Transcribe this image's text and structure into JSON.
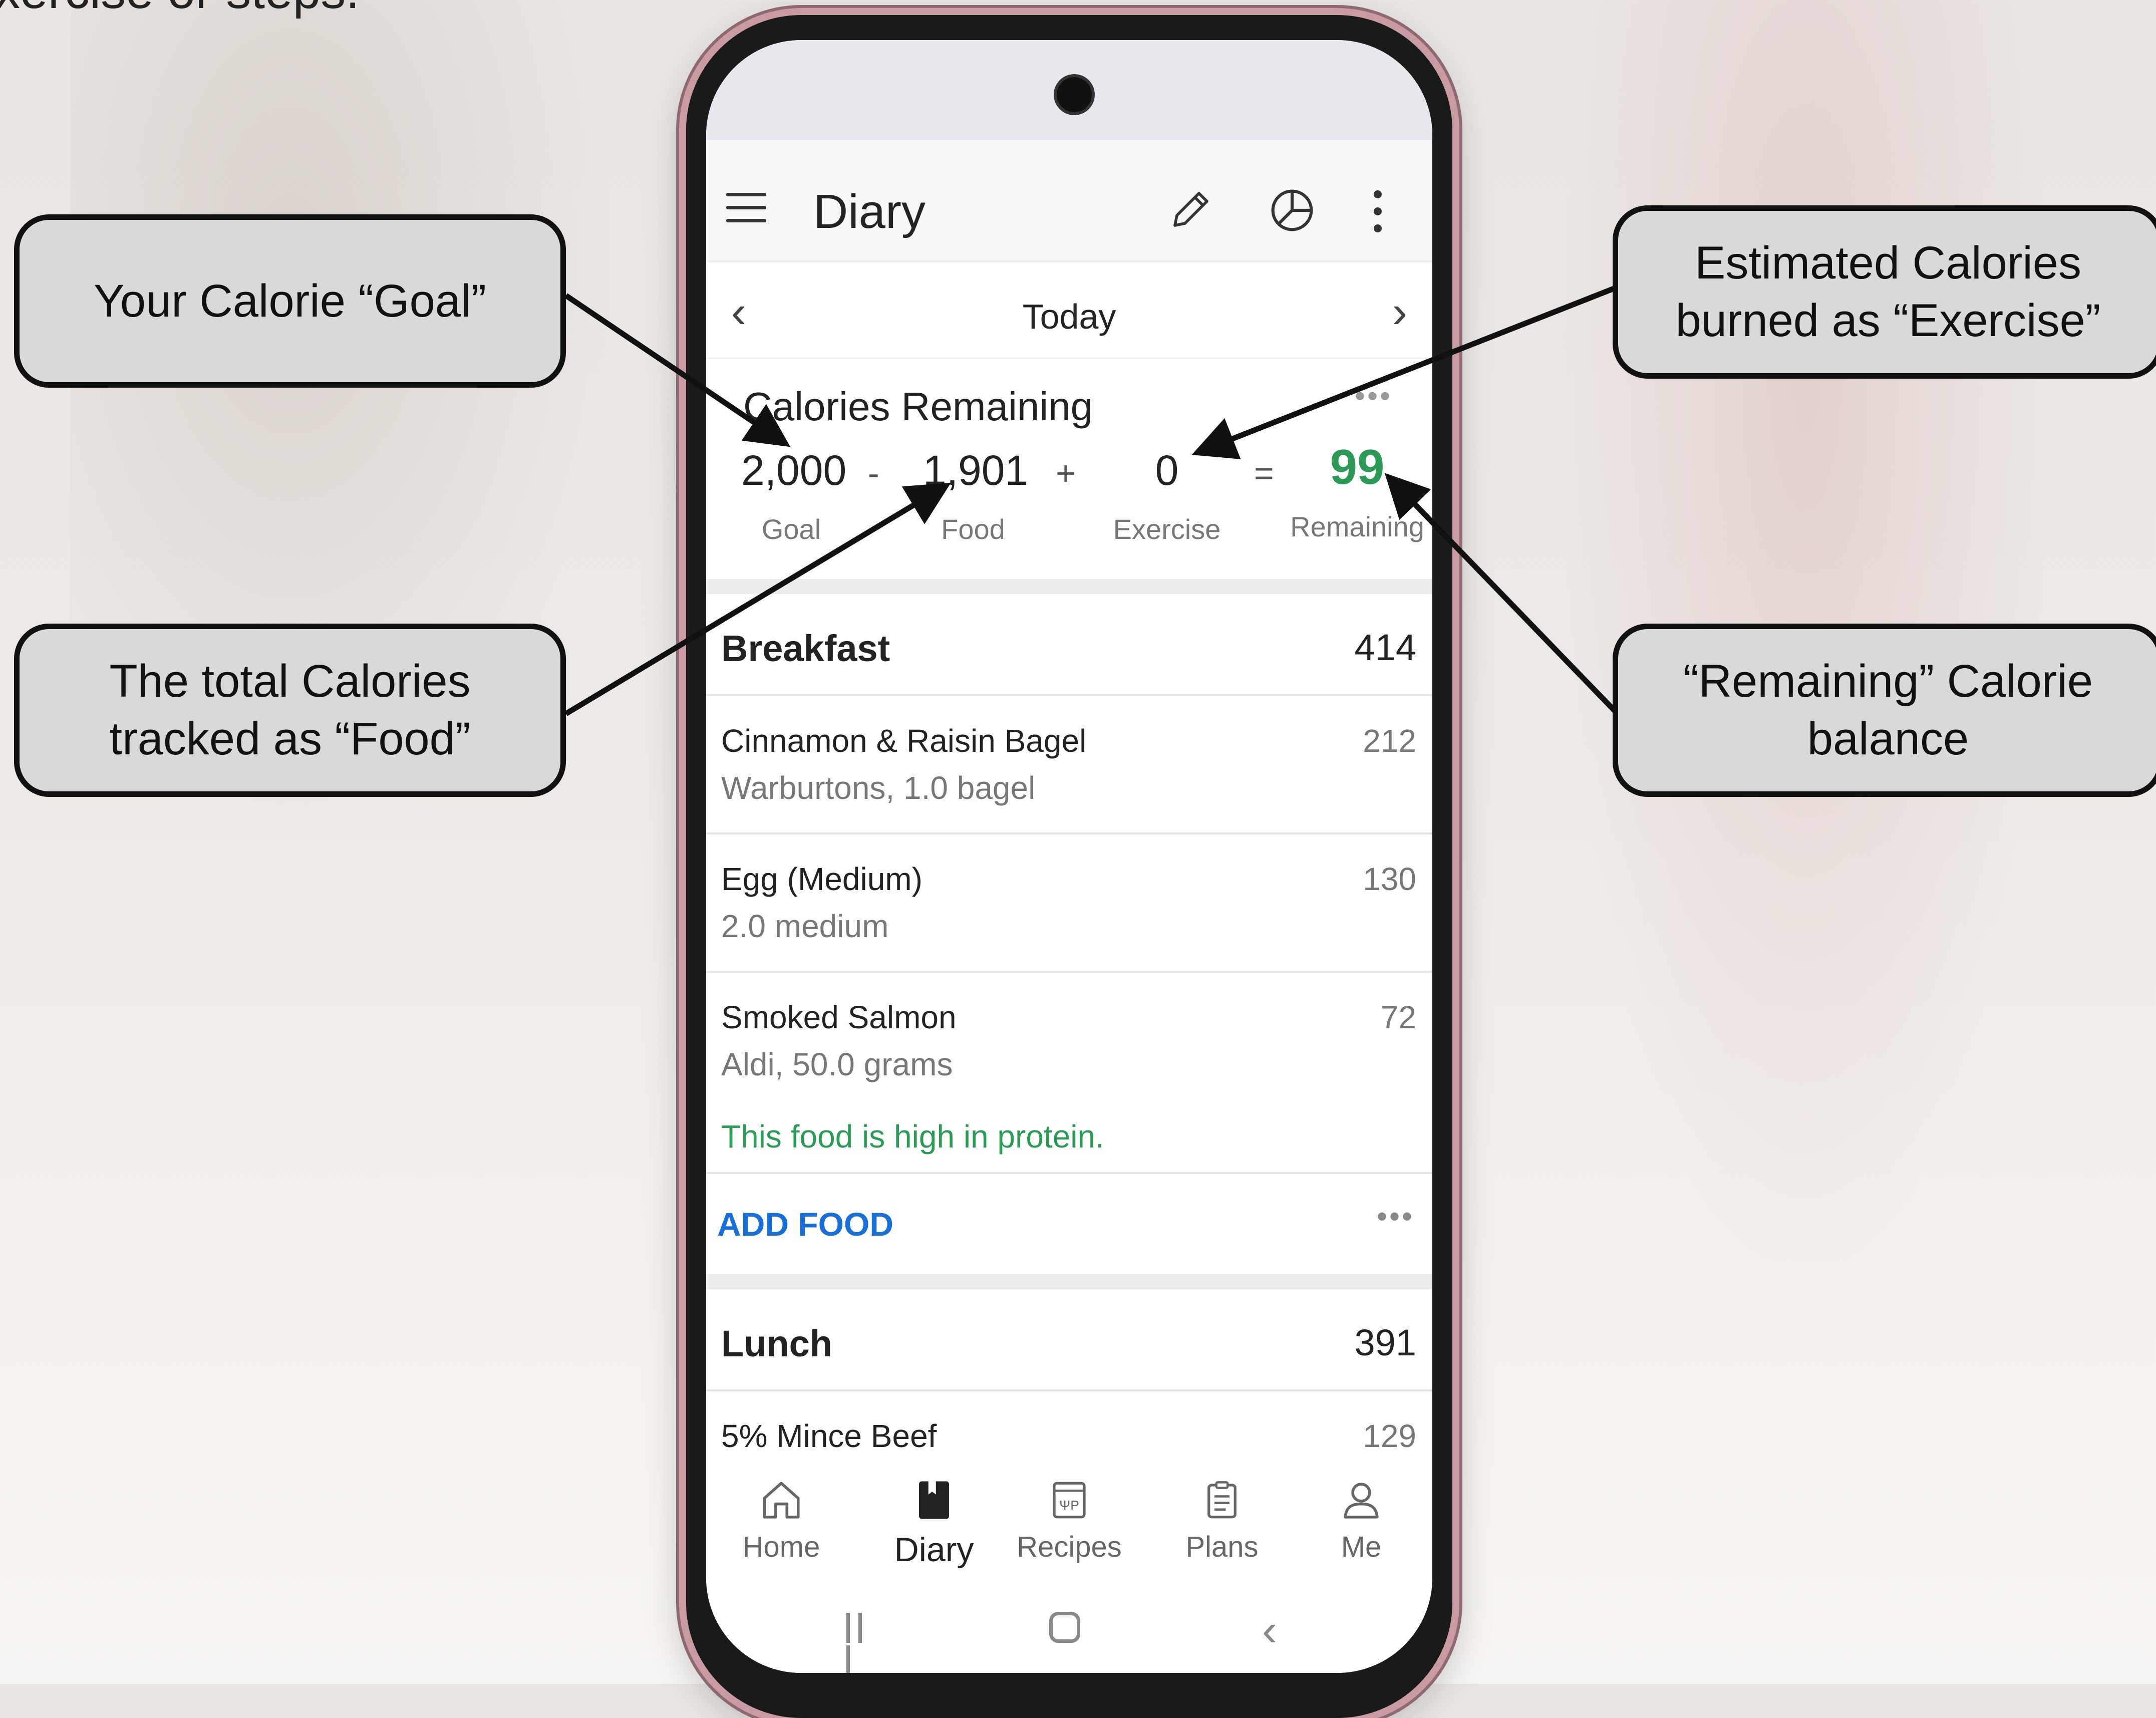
{
  "slide_text": "xercise or steps.",
  "callouts": {
    "goal": "Your Calorie “Goal”",
    "food": "The total Calories\ntracked as “Food”",
    "exercise": "Estimated Calories\nburned as “Exercise”",
    "remaining": "“Remaining” Calorie\nbalance"
  },
  "app": {
    "title": "Diary",
    "date": "Today",
    "calories": {
      "title": "Calories Remaining",
      "more": "•••",
      "goal": {
        "value": "2,000",
        "label": "Goal"
      },
      "minus": "-",
      "food": {
        "value": "1,901",
        "label": "Food"
      },
      "plus": "+",
      "exercise": {
        "value": "0",
        "label": "Exercise"
      },
      "equals": "=",
      "remaining": {
        "value": "99",
        "label": "Remaining"
      }
    },
    "breakfast": {
      "name": "Breakfast",
      "calories": "414",
      "items": [
        {
          "name": "Cinnamon & Raisin Bagel",
          "detail": "Warburtons, 1.0 bagel",
          "calories": "212"
        },
        {
          "name": "Egg (Medium)",
          "detail": "2.0 medium",
          "calories": "130"
        },
        {
          "name": "Smoked Salmon",
          "detail": "Aldi, 50.0 grams",
          "calories": "72",
          "note": "This food is high in protein."
        }
      ],
      "add_food": "ADD FOOD",
      "more": "•••"
    },
    "lunch": {
      "name": "Lunch",
      "calories": "391",
      "items": [
        {
          "name": "5% Mince Beef",
          "calories": "129"
        }
      ]
    },
    "nav": [
      {
        "label": "Home",
        "icon": "home-icon"
      },
      {
        "label": "Diary",
        "icon": "diary-icon"
      },
      {
        "label": "Recipes",
        "icon": "recipes-icon"
      },
      {
        "label": "Plans",
        "icon": "plans-icon"
      },
      {
        "label": "Me",
        "icon": "person-icon"
      }
    ],
    "accent_green": "#2c9a56",
    "link_blue": "#1a6fd6"
  }
}
